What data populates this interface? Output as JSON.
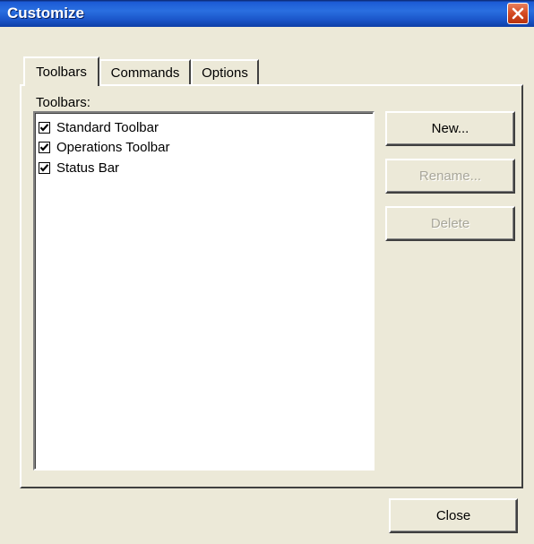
{
  "window": {
    "title": "Customize"
  },
  "tabs": [
    {
      "label": "Toolbars",
      "active": true
    },
    {
      "label": "Commands",
      "active": false
    },
    {
      "label": "Options",
      "active": false
    }
  ],
  "toolbars_panel": {
    "list_label": "Toolbars:",
    "items": [
      {
        "label": "Standard Toolbar",
        "checked": true
      },
      {
        "label": "Operations Toolbar",
        "checked": true
      },
      {
        "label": "Status Bar",
        "checked": true
      }
    ],
    "buttons": {
      "new": {
        "label": "New...",
        "enabled": true
      },
      "rename": {
        "label": "Rename...",
        "enabled": false
      },
      "delete": {
        "label": "Delete",
        "enabled": false
      }
    }
  },
  "footer": {
    "close_label": "Close"
  },
  "colors": {
    "titlebar": "#1c5bd6",
    "dialog_bg": "#ece9d8",
    "close_button": "#d44a22",
    "disabled_text": "#a8a699"
  },
  "icons": {
    "close": "close-icon",
    "check": "checkmark-icon"
  }
}
